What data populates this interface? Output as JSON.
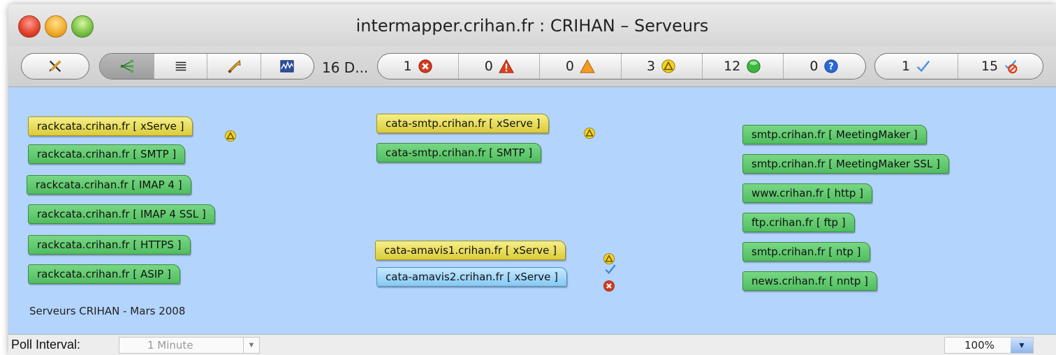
{
  "window": {
    "title": "intermapper.crihan.fr : CRIHAN – Serveurs"
  },
  "toolbar": {
    "device_count": "16 D...",
    "status_counts": [
      {
        "icon": "down-icon",
        "count": "1"
      },
      {
        "icon": "critical-icon",
        "count": "0"
      },
      {
        "icon": "alarm-icon",
        "count": "0"
      },
      {
        "icon": "warning-icon",
        "count": "3"
      },
      {
        "icon": "ok-icon",
        "count": "12"
      },
      {
        "icon": "unknown-icon",
        "count": "0"
      }
    ],
    "ack_counts": [
      {
        "icon": "acknowledged-icon",
        "count": "1"
      },
      {
        "icon": "unacknowledged-icon",
        "count": "15"
      }
    ]
  },
  "map": {
    "nodes": [
      {
        "label": "rackcata.crihan.fr [ xServe ]",
        "status": "warning"
      },
      {
        "label": "rackcata.crihan.fr [ SMTP ]",
        "status": "ok"
      },
      {
        "label": "rackcata.crihan.fr [ IMAP 4 ]",
        "status": "ok"
      },
      {
        "label": "rackcata.crihan.fr [ IMAP 4 SSL ]",
        "status": "ok"
      },
      {
        "label": "rackcata.crihan.fr [ HTTPS ]",
        "status": "ok"
      },
      {
        "label": "rackcata.crihan.fr [ ASIP ]",
        "status": "ok"
      },
      {
        "label": "cata-smtp.crihan.fr [ xServe ]",
        "status": "warning"
      },
      {
        "label": "cata-smtp.crihan.fr [ SMTP ]",
        "status": "ok"
      },
      {
        "label": "cata-amavis1.crihan.fr [ xServe ]",
        "status": "warning"
      },
      {
        "label": "cata-amavis2.crihan.fr [ xServe ]",
        "status": "down-acknowledged"
      },
      {
        "label": "smtp.crihan.fr [ MeetingMaker ]",
        "status": "ok"
      },
      {
        "label": "smtp.crihan.fr [ MeetingMaker SSL ]",
        "status": "ok"
      },
      {
        "label": "www.crihan.fr [ http ]",
        "status": "ok"
      },
      {
        "label": "ftp.crihan.fr [ ftp ]",
        "status": "ok"
      },
      {
        "label": "smtp.crihan.fr [ ntp ]",
        "status": "ok"
      },
      {
        "label": "news.crihan.fr [ nntp ]",
        "status": "ok"
      }
    ],
    "caption": "Serveurs CRIHAN - Mars 2008"
  },
  "statusbar": {
    "poll_label": "Poll Interval:",
    "poll_value": "1 Minute",
    "zoom_value": "100%"
  },
  "colors": {
    "map_background": "#b3d4fc",
    "node_ok": "#5cc46a",
    "node_warning": "#e8de5a",
    "node_acknowledged": "#9dd3f7",
    "status_down": "#d63a1e"
  }
}
